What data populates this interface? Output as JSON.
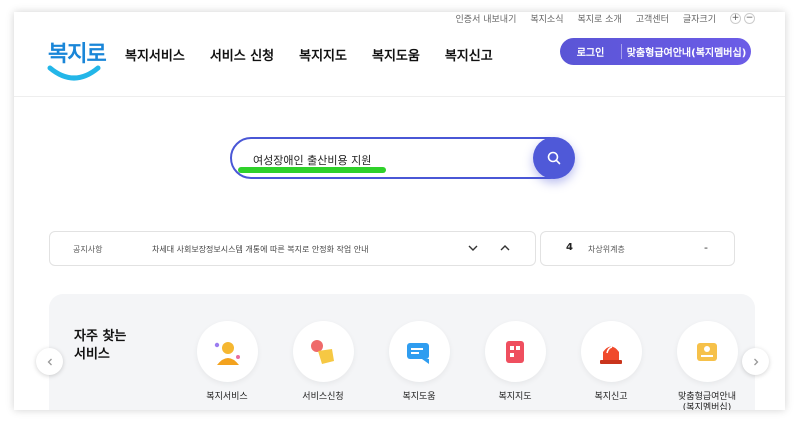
{
  "utility": {
    "links": [
      "인증서 내보내기",
      "복지소식",
      "복지로 소개",
      "고객센터",
      "글자크기"
    ],
    "zoom_in": "+",
    "zoom_out": "−"
  },
  "logo": {
    "text": "복지로"
  },
  "nav": {
    "items": [
      "복지서비스",
      "서비스 신청",
      "복지지도",
      "복지도움",
      "복지신고"
    ]
  },
  "header_buttons": {
    "login": "로그인",
    "custom": "맞춤형급여안내(복지멤버십)"
  },
  "search": {
    "value": "여성장애인 출산비용 지원"
  },
  "notice": {
    "label": "공지사항",
    "text": "차세대 사회보장정보시스템 개통에 따른 복지로 안정화 작업 안내"
  },
  "stat": {
    "number": "4",
    "label": "차상위계층",
    "dash": "-"
  },
  "services": {
    "title": "자주 찾는\n서비스",
    "items": [
      {
        "label": "복지서비스",
        "icon": "person-icon"
      },
      {
        "label": "서비스신청",
        "icon": "hand-pointer-icon"
      },
      {
        "label": "복지도움",
        "icon": "chat-icon"
      },
      {
        "label": "복지지도",
        "icon": "map-icon"
      },
      {
        "label": "복지신고",
        "icon": "siren-icon"
      },
      {
        "label": "맞춤형급여안내\n(복지멤버십)",
        "icon": "id-card-icon"
      }
    ]
  },
  "colors": {
    "accent": "#4f59d8",
    "highlight": "#2fd12a",
    "logo": "#1a86d8"
  }
}
